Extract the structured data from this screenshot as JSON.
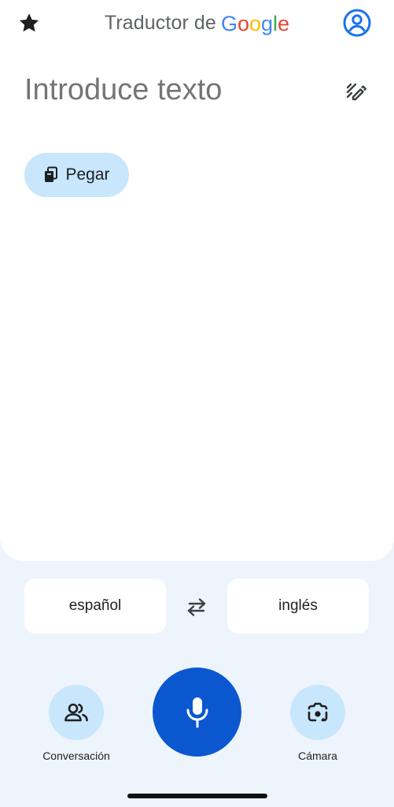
{
  "header": {
    "title_prefix": "Traductor de",
    "brand_letters": [
      {
        "char": "G",
        "color": "#4285F4"
      },
      {
        "char": "o",
        "color": "#EA4335"
      },
      {
        "char": "o",
        "color": "#FBBC05"
      },
      {
        "char": "g",
        "color": "#4285F4"
      },
      {
        "char": "l",
        "color": "#34A853"
      },
      {
        "char": "e",
        "color": "#EA4335"
      }
    ],
    "icons": {
      "left": "star-icon",
      "right": "account-circle-icon"
    }
  },
  "input": {
    "placeholder": "Introduce texto",
    "value": "",
    "handwriting_icon": "handwriting-pen-icon"
  },
  "paste": {
    "label": "Pegar",
    "icon": "clipboard-icon"
  },
  "languages": {
    "source": "español",
    "target": "inglés",
    "swap_icon": "swap-arrows-icon"
  },
  "actions": {
    "conversation_label": "Conversación",
    "conversation_icon": "people-icon",
    "microphone_icon": "microphone-icon",
    "camera_label": "Cámara",
    "camera_icon": "lens-camera-icon"
  },
  "colors": {
    "accent": "#0b57d0",
    "account_blue": "#1a73e8",
    "chip_bg": "#c8e6fc",
    "bottom_bg": "#eef4fb"
  }
}
